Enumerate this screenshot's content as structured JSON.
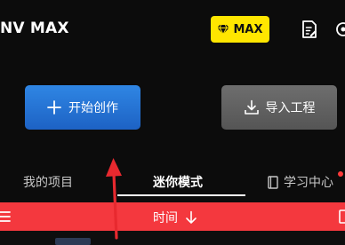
{
  "header": {
    "app_title": "NV MAX",
    "badge_label": "MAX",
    "icons": {
      "badge": "diamond-icon",
      "document": "document-edit-icon",
      "edge": "settings-icon"
    }
  },
  "actions": {
    "start_label": "开始创作",
    "import_label": "导入工程",
    "icons": {
      "start": "plus-icon",
      "import": "download-icon"
    }
  },
  "tabs": [
    {
      "label": "我的项目",
      "active": false
    },
    {
      "label": "迷你模式",
      "active": true
    },
    {
      "label": "学习中心",
      "active": false,
      "icon": "book-icon",
      "has_notification": true
    }
  ],
  "sort_bar": {
    "label": "时间",
    "icons": {
      "menu": "menu-icon",
      "sort": "arrow-down-icon"
    }
  },
  "colors": {
    "background": "#0c0c0c",
    "badge": "#ffe600",
    "start_button": "#2a7dde",
    "import_button": "#626262",
    "sort_bar": "#f4383e",
    "annotation_arrow": "#e8292f"
  }
}
